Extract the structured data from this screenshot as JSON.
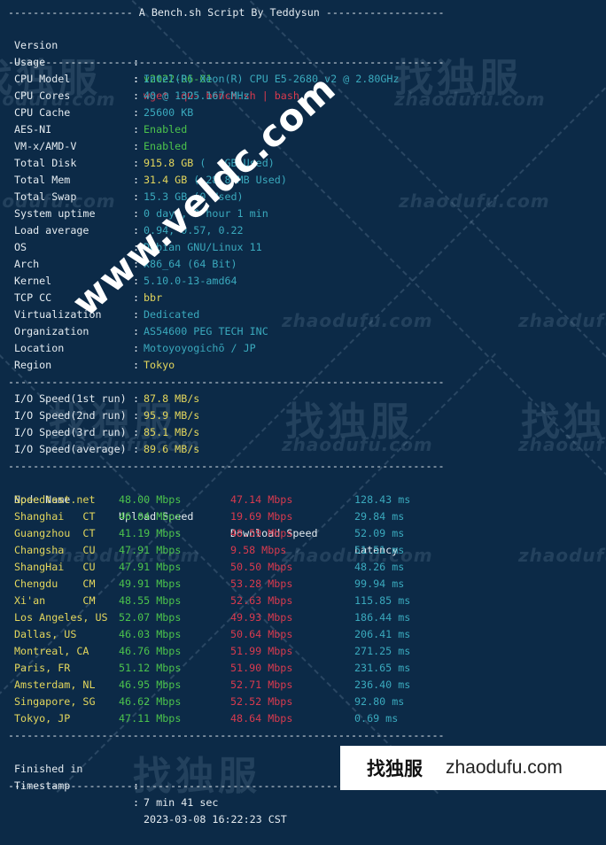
{
  "header": {
    "title_line": "-------------------- A Bench.sh Script By Teddysun -------------------",
    "separator": "----------------------------------------------------------------------"
  },
  "info_block_1": [
    {
      "label": "Version",
      "value": "v2022-06-01",
      "color": "green"
    },
    {
      "label": "Usage",
      "value": "wget -qO- bench.sh | bash",
      "color": "red"
    }
  ],
  "system_info": [
    {
      "label": "CPU Model",
      "value": "Intel(R) Xeon(R) CPU E5-2680 v2 @ 2.80GHz",
      "color": "cyan"
    },
    {
      "label": "CPU Cores",
      "value": "40 @ 1325.167 MHz",
      "color": "cyan"
    },
    {
      "label": "CPU Cache",
      "value": "25600 KB",
      "color": "cyan"
    },
    {
      "label": "AES-NI",
      "value": "Enabled",
      "color": "green"
    },
    {
      "label": "VM-x/AMD-V",
      "value": "Enabled",
      "color": "green"
    },
    {
      "label": "Total Disk",
      "value": "915.8 GB",
      "value_extra": " (   GB Used)",
      "color": "yellow"
    },
    {
      "label": "Total Mem",
      "value": "31.4 GB",
      "value_extra": " ( 28.8 MB Used)",
      "color": "yellow"
    },
    {
      "label": "Total Swap",
      "value": "15.3 GB (0 Used)",
      "color": "cyan"
    },
    {
      "label": "System uptime",
      "value": "0 days, 0 hour 1 min",
      "color": "cyan"
    },
    {
      "label": "Load average",
      "value": "0.94, 0.57, 0.22",
      "color": "cyan"
    },
    {
      "label": "OS",
      "value": "Debian GNU/Linux 11",
      "color": "cyan"
    },
    {
      "label": "Arch",
      "value": "x86_64 (64 Bit)",
      "color": "cyan"
    },
    {
      "label": "Kernel",
      "value": "5.10.0-13-amd64",
      "color": "cyan"
    },
    {
      "label": "TCP CC",
      "value": "bbr",
      "color": "yellow"
    },
    {
      "label": "Virtualization",
      "value": "Dedicated",
      "color": "cyan"
    },
    {
      "label": "Organization",
      "value": "AS54600 PEG TECH INC",
      "color": "cyan"
    },
    {
      "label": "Location",
      "value": "Motoyoyogichō / JP",
      "color": "cyan"
    },
    {
      "label": "Region",
      "value": "Tokyo",
      "color": "yellow"
    }
  ],
  "io_speed": [
    {
      "label": "I/O Speed(1st run)",
      "value": "87.8 MB/s"
    },
    {
      "label": "I/O Speed(2nd run)",
      "value": "95.9 MB/s"
    },
    {
      "label": "I/O Speed(3rd run)",
      "value": "85.1 MB/s"
    },
    {
      "label": "I/O Speed(average)",
      "value": "89.6 MB/s"
    }
  ],
  "speed_table": {
    "headers": [
      "Node Name",
      "Upload Speed",
      "Download Speed",
      "Latency"
    ],
    "rows": [
      {
        "node": "Speedtest.net",
        "upload": "48.00 Mbps",
        "download": "47.14 Mbps",
        "latency": "128.43 ms"
      },
      {
        "node": "Shanghai   CT",
        "upload": "46.04 Mbps",
        "download": "19.69 Mbps",
        "latency": "29.84 ms"
      },
      {
        "node": "Guangzhou  CT",
        "upload": "41.19 Mbps",
        "download": "48.59 Mbps",
        "latency": "52.09 ms"
      },
      {
        "node": "Changsha   CU",
        "upload": "47.91 Mbps",
        "download": "9.58 Mbps",
        "latency": "51.51 ms"
      },
      {
        "node": "ShangHai   CU",
        "upload": "47.91 Mbps",
        "download": "50.50 Mbps",
        "latency": "48.26 ms"
      },
      {
        "node": "Chengdu    CM",
        "upload": "49.91 Mbps",
        "download": "53.28 Mbps",
        "latency": "99.94 ms"
      },
      {
        "node": "Xi'an      CM",
        "upload": "48.55 Mbps",
        "download": "52.63 Mbps",
        "latency": "115.85 ms"
      },
      {
        "node": "Los Angeles, US",
        "upload": "52.07 Mbps",
        "download": "49.93 Mbps",
        "latency": "186.44 ms"
      },
      {
        "node": "Dallas, US",
        "upload": "46.03 Mbps",
        "download": "50.64 Mbps",
        "latency": "206.41 ms"
      },
      {
        "node": "Montreal, CA",
        "upload": "46.76 Mbps",
        "download": "51.99 Mbps",
        "latency": "271.25 ms"
      },
      {
        "node": "Paris, FR",
        "upload": "51.12 Mbps",
        "download": "51.90 Mbps",
        "latency": "231.65 ms"
      },
      {
        "node": "Amsterdam, NL",
        "upload": "46.95 Mbps",
        "download": "52.71 Mbps",
        "latency": "236.40 ms"
      },
      {
        "node": "Singapore, SG",
        "upload": "46.62 Mbps",
        "download": "52.52 Mbps",
        "latency": "92.80 ms"
      },
      {
        "node": "Tokyo, JP",
        "upload": "47.11 Mbps",
        "download": "48.64 Mbps",
        "latency": "0.69 ms"
      }
    ]
  },
  "footer": [
    {
      "label": "Finished in",
      "value": "7 min 41 sec"
    },
    {
      "label": "Timestamp",
      "value": "2023-03-08 16:22:23 CST"
    }
  ],
  "watermarks": {
    "overlay": "www.veldc.com",
    "cn": "找独服",
    "en": "zhaodufu.com"
  },
  "brand_box": {
    "cn": "找独服",
    "en": "zhaodufu.com"
  }
}
